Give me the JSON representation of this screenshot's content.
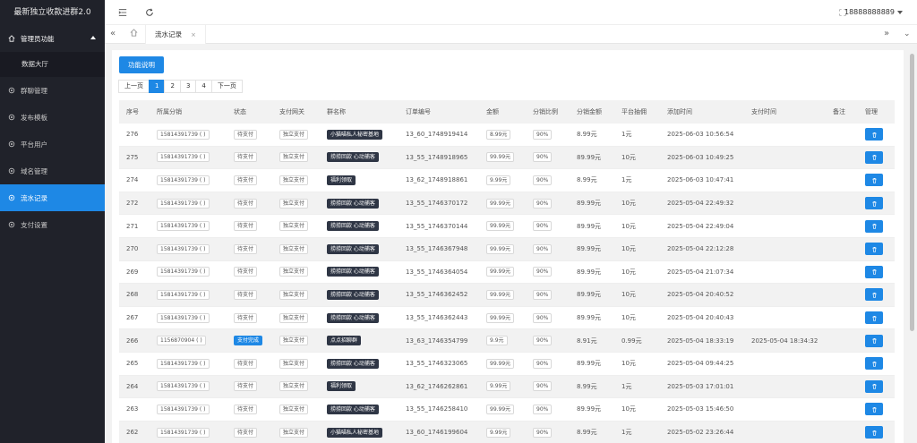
{
  "app_title": "最新独立收款进群2.0",
  "sidebar": {
    "items": [
      {
        "label": "管理员功能",
        "icon": "home-icon"
      },
      {
        "label": "数据大厅"
      },
      {
        "label": "群聊管理",
        "icon": "settings-icon"
      },
      {
        "label": "发布模板",
        "icon": "settings-icon"
      },
      {
        "label": "平台用户",
        "icon": "settings-icon"
      },
      {
        "label": "域名管理",
        "icon": "settings-icon"
      },
      {
        "label": "流水记录",
        "icon": "settings-icon"
      },
      {
        "label": "支付设置",
        "icon": "settings-icon"
      }
    ]
  },
  "header": {
    "user": "18888888889"
  },
  "tabs": [
    {
      "label": "流水记录",
      "close": "×"
    }
  ],
  "help_button": "功能说明",
  "pager": {
    "prev": "上一页",
    "pages": [
      "1",
      "2",
      "3",
      "4"
    ],
    "next": "下一页",
    "current": "1"
  },
  "table": {
    "headers": [
      "序号",
      "所属分销",
      "状态",
      "支付网关",
      "群名称",
      "订单编号",
      "金额",
      "分销比例",
      "分销金额",
      "平台抽佣",
      "添加时间",
      "支付时间",
      "备注",
      "管理"
    ],
    "rows": [
      [
        "276",
        "15814391739 ( )",
        "待支付",
        "独立支付",
        "小猫喵私人秘密基地",
        "13_60_1748919414",
        "8.99元",
        "90%",
        "8.99元",
        "1元",
        "2025-06-03 10:56:54",
        "",
        ""
      ],
      [
        "275",
        "15814391739 ( )",
        "待支付",
        "独立支付",
        "捞捞回款 心动捕客",
        "13_55_1748918965",
        "99.99元",
        "90%",
        "89.99元",
        "10元",
        "2025-06-03 10:49:25",
        "",
        ""
      ],
      [
        "274",
        "15814391739 ( )",
        "待支付",
        "独立支付",
        "福利领取",
        "13_62_1748918861",
        "9.99元",
        "90%",
        "8.99元",
        "1元",
        "2025-06-03 10:47:41",
        "",
        ""
      ],
      [
        "272",
        "15814391739 ( )",
        "待支付",
        "独立支付",
        "捞捞回款 心动捕客",
        "13_55_1746370172",
        "99.99元",
        "90%",
        "89.99元",
        "10元",
        "2025-05-04 22:49:32",
        "",
        ""
      ],
      [
        "271",
        "15814391739 ( )",
        "待支付",
        "独立支付",
        "捞捞回款 心动捕客",
        "13_55_1746370144",
        "99.99元",
        "90%",
        "89.99元",
        "10元",
        "2025-05-04 22:49:04",
        "",
        ""
      ],
      [
        "270",
        "15814391739 ( )",
        "待支付",
        "独立支付",
        "捞捞回款 心动捕客",
        "13_55_1746367948",
        "99.99元",
        "90%",
        "89.99元",
        "10元",
        "2025-05-04 22:12:28",
        "",
        ""
      ],
      [
        "269",
        "15814391739 ( )",
        "待支付",
        "独立支付",
        "捞捞回款 心动捕客",
        "13_55_1746364054",
        "99.99元",
        "90%",
        "89.99元",
        "10元",
        "2025-05-04 21:07:34",
        "",
        ""
      ],
      [
        "268",
        "15814391739 ( )",
        "待支付",
        "独立支付",
        "捞捞回款 心动捕客",
        "13_55_1746362452",
        "99.99元",
        "90%",
        "89.99元",
        "10元",
        "2025-05-04 20:40:52",
        "",
        ""
      ],
      [
        "267",
        "15814391739 ( )",
        "待支付",
        "独立支付",
        "捞捞回款 心动捕客",
        "13_55_1746362443",
        "99.99元",
        "90%",
        "89.99元",
        "10元",
        "2025-05-04 20:40:43",
        "",
        ""
      ],
      [
        "266",
        "1156870904 ( )",
        "支付完成",
        "独立支付",
        "点点招聊群",
        "13_63_1746354799",
        "9.9元",
        "90%",
        "8.91元",
        "0.99元",
        "2025-05-04 18:33:19",
        "2025-05-04 18:34:32",
        ""
      ],
      [
        "265",
        "15814391739 ( )",
        "待支付",
        "独立支付",
        "捞捞回款 心动捕客",
        "13_55_1746323065",
        "99.99元",
        "90%",
        "89.99元",
        "10元",
        "2025-05-04 09:44:25",
        "",
        ""
      ],
      [
        "264",
        "15814391739 ( )",
        "待支付",
        "独立支付",
        "福利领取",
        "13_62_1746262861",
        "9.99元",
        "90%",
        "8.99元",
        "1元",
        "2025-05-03 17:01:01",
        "",
        ""
      ],
      [
        "263",
        "15814391739 ( )",
        "待支付",
        "独立支付",
        "捞捞回款 心动捕客",
        "13_55_1746258410",
        "99.99元",
        "90%",
        "89.99元",
        "10元",
        "2025-05-03 15:46:50",
        "",
        ""
      ],
      [
        "262",
        "15814391739 ( )",
        "待支付",
        "独立支付",
        "小猫喵私人秘密基地",
        "13_60_1746199604",
        "9.99元",
        "90%",
        "8.99元",
        "1元",
        "2025-05-02 23:26:44",
        "",
        ""
      ]
    ]
  },
  "colors": {
    "accent": "#1e88e5",
    "sidebar_bg": "#20222a",
    "sidebar_sub_bg": "#191a22",
    "dark_tag": "#2f3645"
  }
}
